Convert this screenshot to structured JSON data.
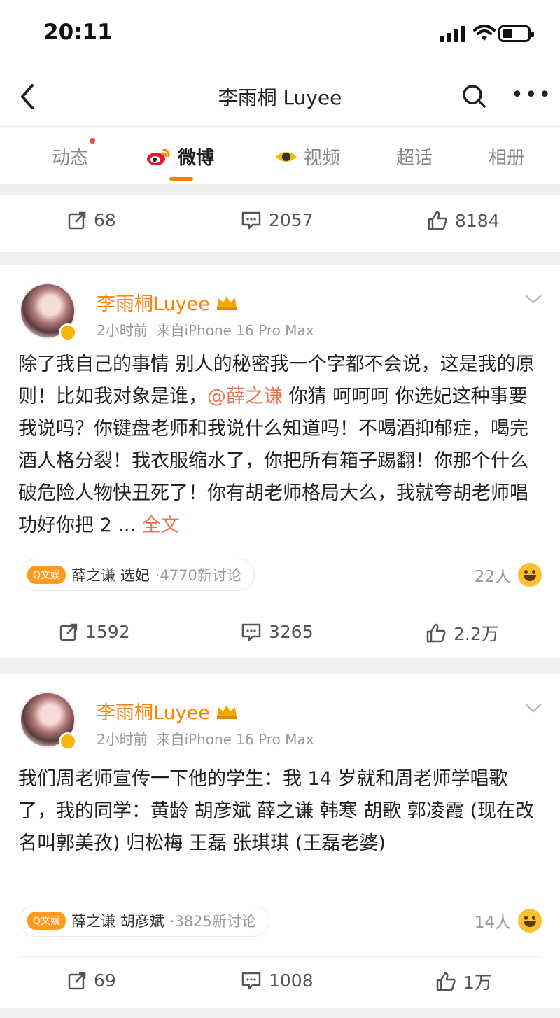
{
  "status_bar": {
    "time": "20:11"
  },
  "nav": {
    "title": "李雨桐 Luyee"
  },
  "tabs": [
    {
      "label": "动态"
    },
    {
      "label": "微博"
    },
    {
      "label": "视频"
    },
    {
      "label": "超话"
    },
    {
      "label": "相册"
    }
  ],
  "top_actions": {
    "repost": "68",
    "comment": "2057",
    "like": "8184"
  },
  "posts": [
    {
      "author": "李雨桐Luyee",
      "time": "2小时前",
      "source": "来自iPhone 16 Pro Max",
      "text_1": "除了我自己的事情 别人的秘密我一个字都不会说，这是我的原则！比如我对象是谁，",
      "mention": "@薛之谦",
      "text_2": " 你猜 呵呵呵 你选妃这种事要我说吗？你键盘老师和我说什么知道吗！不喝酒抑郁症，喝完酒人格分裂！我衣服缩水了，你把所有箱子踢翻！你那个什么破危险人物快丑死了！你有胡老师格局大么，我就夸胡老师唱功好你把 2 ... ",
      "more": "全文",
      "topic_tag": "Q文娱",
      "topic": "薛之谦 选妃",
      "topic_count": "·4770新讨论",
      "likers": "22人",
      "repost": "1592",
      "comment": "3265",
      "like": "2.2万"
    },
    {
      "author": "李雨桐Luyee",
      "time": "2小时前",
      "source": "来自iPhone 16 Pro Max",
      "text_1": "我们周老师宣传一下他的学生：我 14 岁就和周老师学唱歌了，我的同学：黄龄 胡彦斌 薛之谦 韩寒 胡歌 郭凌霞 (现在改名叫郭美孜) 归松梅 王磊 张琪琪 (王磊老婆)",
      "topic_tag": "Q文娱",
      "topic": "薛之谦 胡彦斌",
      "topic_count": "·3825新讨论",
      "likers": "14人",
      "repost": "69",
      "comment": "1008",
      "like": "1万"
    }
  ],
  "colors": {
    "accent": "#ff8200",
    "link": "#eb7350",
    "badge": "#f7b500"
  }
}
